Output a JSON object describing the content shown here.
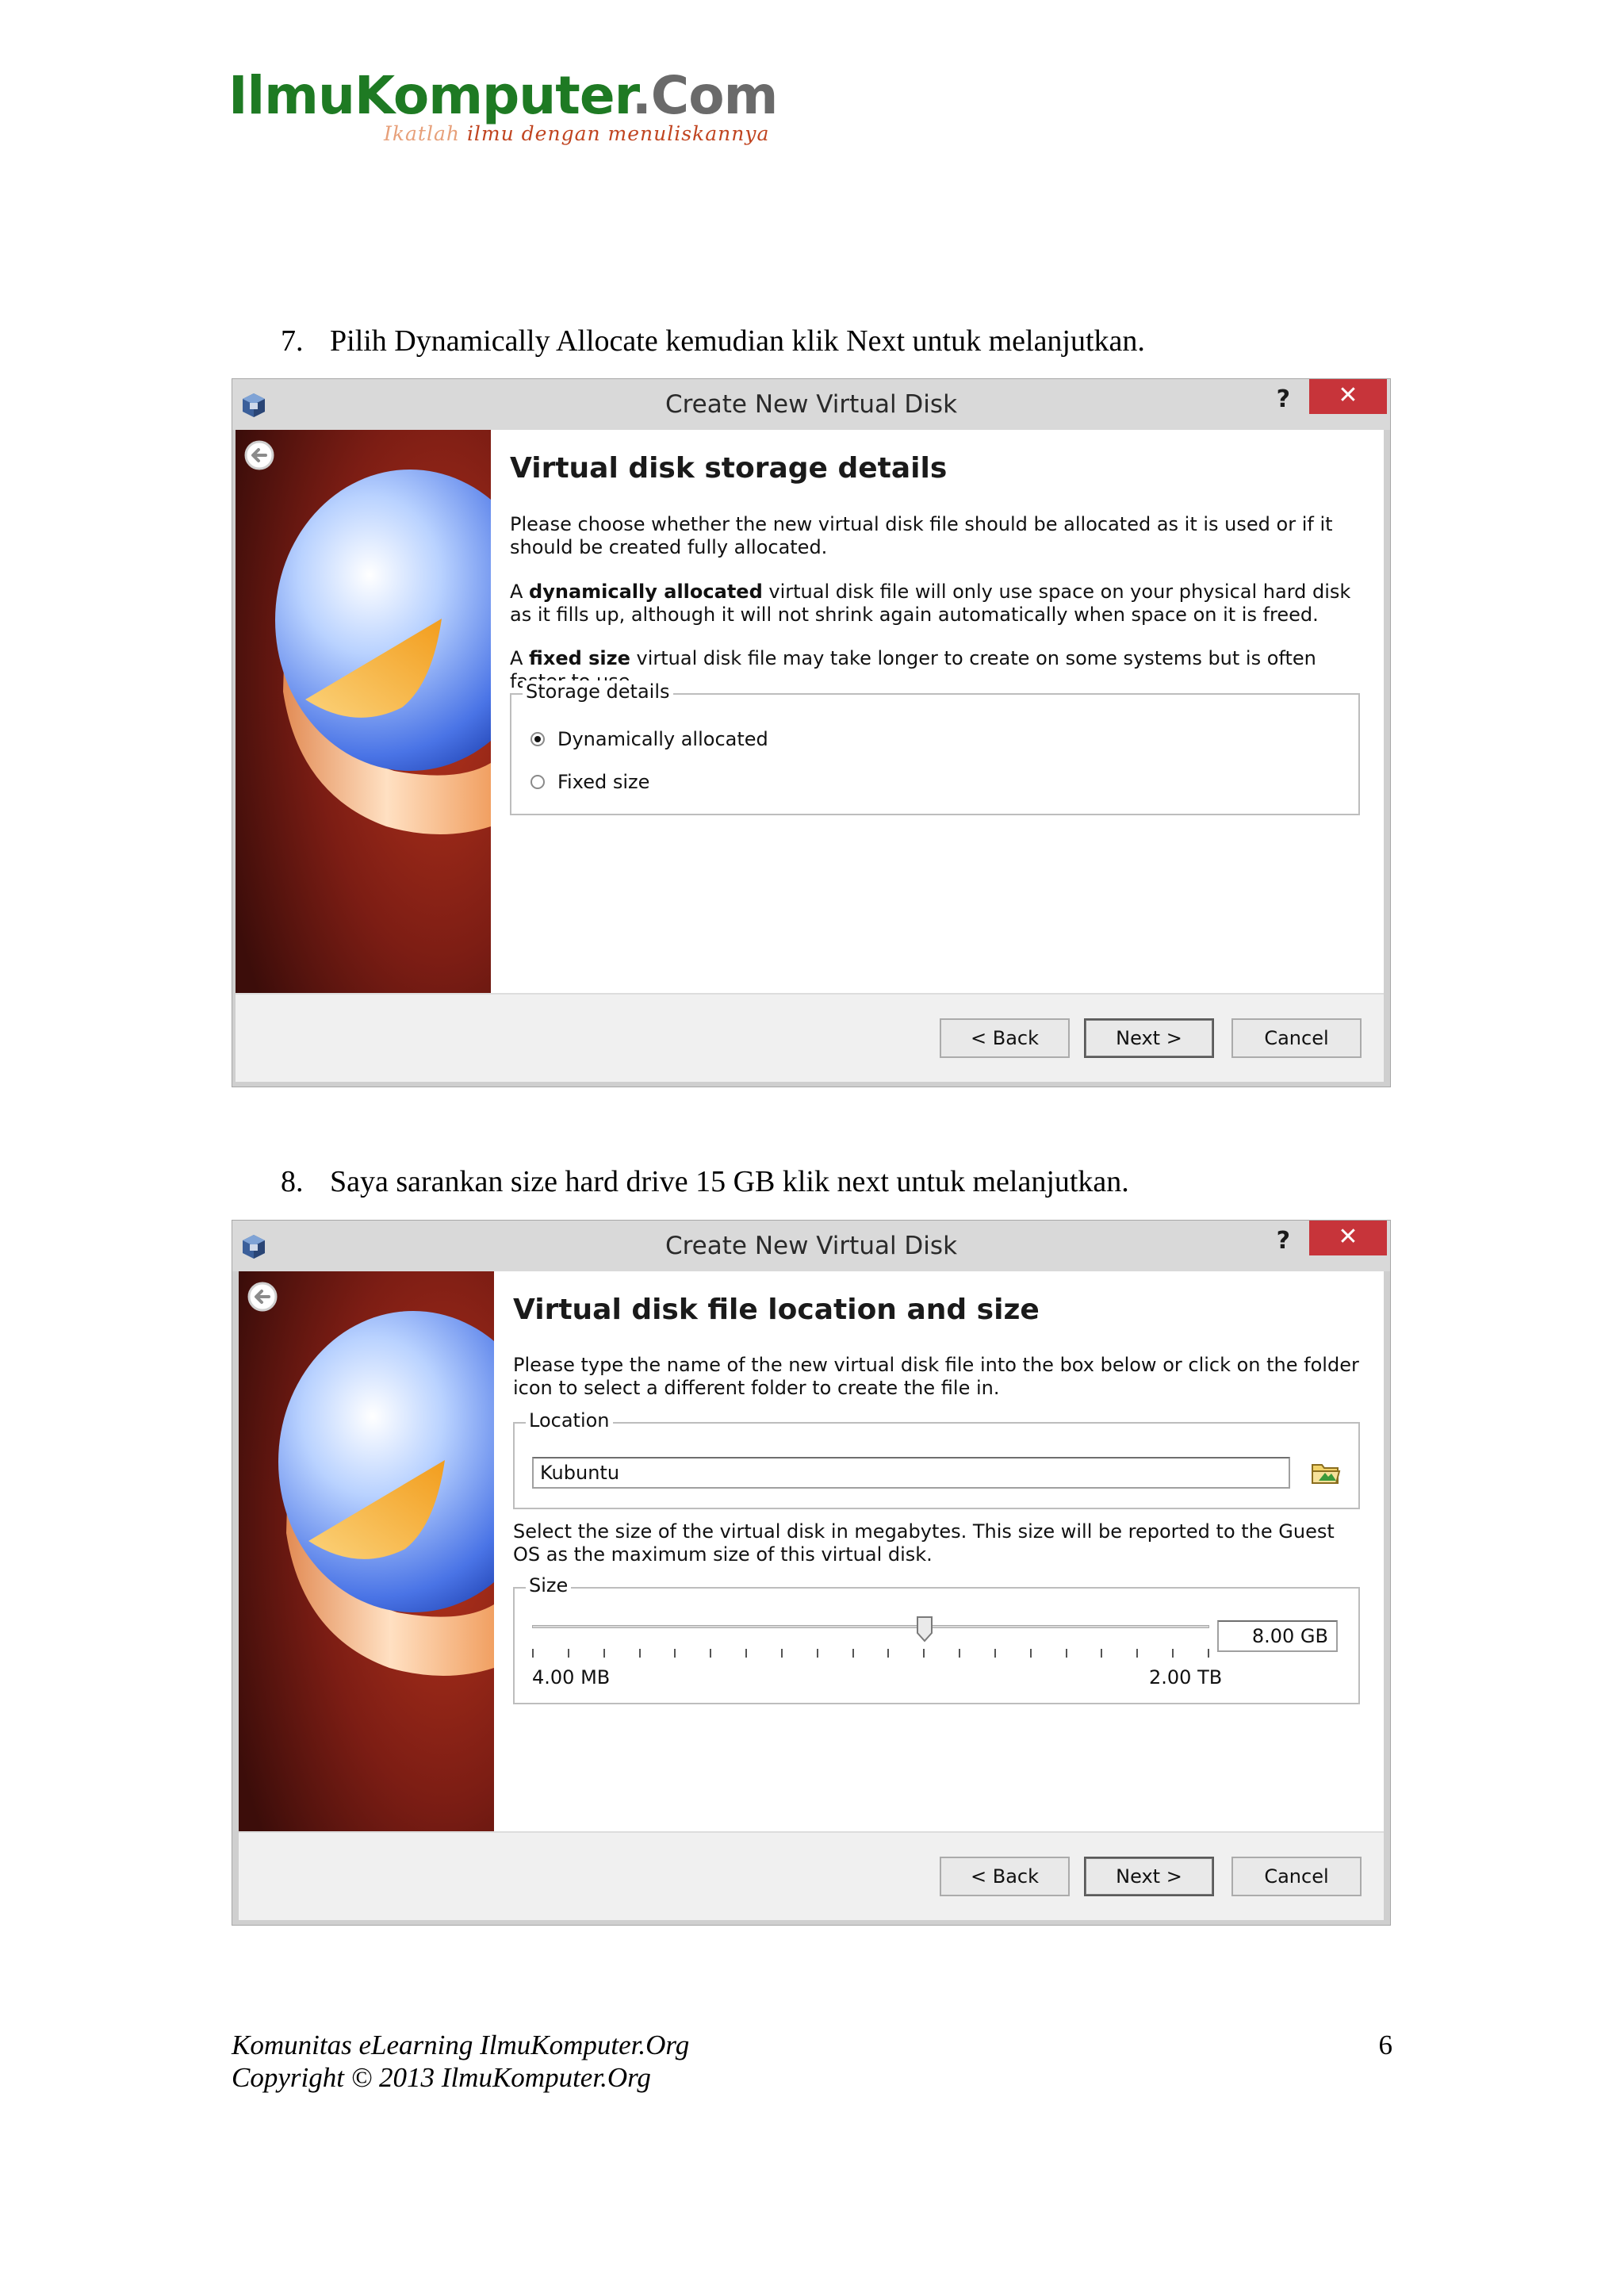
{
  "logo": {
    "brand_part1": "IlmuKomputer",
    "brand_part2": ".Com",
    "tagline_part1": "Ikatlah ",
    "tagline_part2": "ilmu dengan menuliskannya"
  },
  "step7": {
    "number": "7.",
    "text": "Pilih Dynamically Allocate kemudian klik Next untuk melanjutkan."
  },
  "dialog1": {
    "title": "Create New Virtual Disk",
    "help": "?",
    "close": "✕",
    "heading": "Virtual disk storage details",
    "para1": "Please choose whether the new virtual disk file should be allocated as it is used or if it should be created fully allocated.",
    "para2_prefix": "A ",
    "para2_bold": "dynamically allocated",
    "para2_rest": " virtual disk file will only use space on your physical hard disk as it fills up, although it will not shrink again automatically when space on it is freed.",
    "para3_prefix": "A ",
    "para3_bold": "fixed size",
    "para3_rest": " virtual disk file may take longer to create on some systems but is often faster to use.",
    "group_label": "Storage details",
    "option1": "Dynamically allocated",
    "option2": "Fixed size",
    "selected": "Dynamically allocated",
    "back": "< Back",
    "next": "Next >",
    "cancel": "Cancel"
  },
  "step8": {
    "number": "8.",
    "text": "Saya sarankan size hard drive 15 GB klik next untuk melanjutkan."
  },
  "dialog2": {
    "title": "Create New Virtual Disk",
    "help": "?",
    "close": "✕",
    "heading": "Virtual disk file location and size",
    "para1": "Please type the name of the new virtual disk file into the box below or click on the folder icon to select a different folder to create the file in.",
    "location_label": "Location",
    "location_value": "Kubuntu",
    "para2": "Select the size of the virtual disk in megabytes. This size will be reported to the Guest OS as the maximum size of this virtual disk.",
    "size_label": "Size",
    "size_value": "8.00 GB",
    "slider_fraction": 0.58,
    "slider_min": "4.00 MB",
    "slider_max": "2.00 TB",
    "back": "< Back",
    "next": "Next >",
    "cancel": "Cancel"
  },
  "footer": {
    "line1": "Komunitas eLearning IlmuKomputer.Org",
    "line2": "Copyright © 2013 IlmuKomputer.Org",
    "page": "6"
  }
}
